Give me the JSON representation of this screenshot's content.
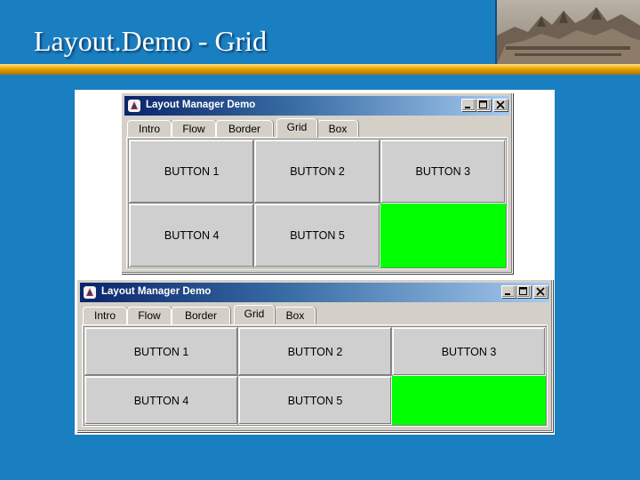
{
  "slide": {
    "title": "Layout.Demo - Grid"
  },
  "window_top": {
    "title": "Layout Manager Demo",
    "tabs": [
      "Intro",
      "Flow",
      "Border",
      "Grid",
      "Box"
    ],
    "selected_tab": "Grid",
    "buttons": [
      "BUTTON 1",
      "BUTTON 2",
      "BUTTON 3",
      "BUTTON 4",
      "BUTTON 5"
    ]
  },
  "window_bottom": {
    "title": "Layout Manager Demo",
    "tabs": [
      "Intro",
      "Flow",
      "Border",
      "Grid",
      "Box"
    ],
    "selected_tab": "Grid",
    "buttons": [
      "BUTTON 1",
      "BUTTON 2",
      "BUTTON 3",
      "BUTTON 4",
      "BUTTON 5"
    ]
  },
  "colors": {
    "background": "#1a7fc1",
    "title_rule": "#e8a400",
    "filler_cell": "#00ff00",
    "titlebar_start": "#0a246a",
    "titlebar_end": "#a6caf0"
  },
  "icons": {
    "header_image": "temple-photo",
    "window_icon": "java-duke-icon",
    "minimize": "minimize-icon",
    "maximize": "maximize-icon",
    "close": "close-icon"
  }
}
